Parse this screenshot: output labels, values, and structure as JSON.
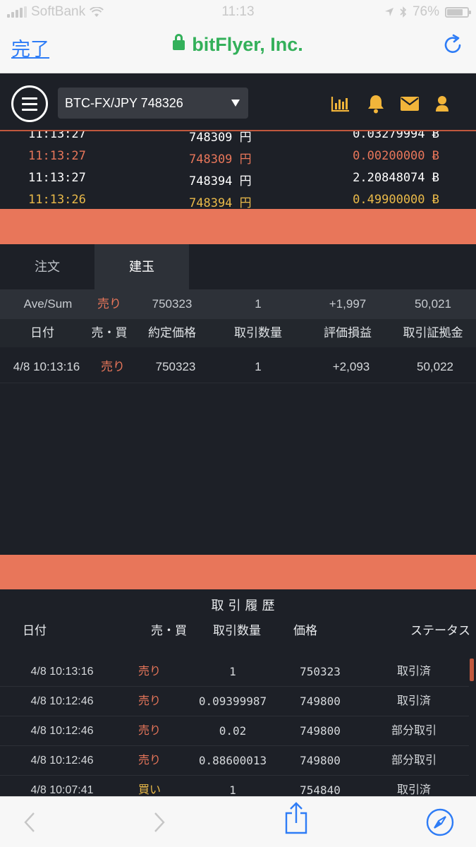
{
  "status_bar": {
    "carrier": "SoftBank",
    "time": "11:13",
    "battery": "76%"
  },
  "browser": {
    "done_label": "完了",
    "site_title": "bitFlyer, Inc."
  },
  "header": {
    "pair": "BTC-FX/JPY 748326"
  },
  "feed": [
    {
      "time": "11:13:27",
      "price": "748309 円",
      "size": "0.03279994 Ƀ",
      "color": "#ffffff"
    },
    {
      "time": "11:13:27",
      "price": "748309 円",
      "size": "0.00200000 Ƀ",
      "color": "#e8765a"
    },
    {
      "time": "11:13:27",
      "price": "748394 円",
      "size": "2.20848074 Ƀ",
      "color": "#ffffff"
    },
    {
      "time": "11:13:26",
      "price": "748394 円",
      "size": "0.49900000 Ƀ",
      "color": "#e9b949"
    }
  ],
  "tabs": {
    "order": "注文",
    "position": "建玉"
  },
  "summary": {
    "label": "Ave/Sum",
    "side": "売り",
    "price": "750323",
    "qty": "1",
    "pnl": "+1,997",
    "margin": "50,021"
  },
  "position_columns": {
    "date": "日付",
    "side": "売・買",
    "price": "約定価格",
    "qty": "取引数量",
    "pnl": "評価損益",
    "margin": "取引証拠金"
  },
  "positions": [
    {
      "date": "4/8 10:13:16",
      "side": "売り",
      "price": "750323",
      "qty": "1",
      "pnl": "+2,093",
      "margin": "50,022"
    }
  ],
  "history": {
    "title": "取引履歴",
    "columns": {
      "date": "日付",
      "side": "売・買",
      "qty": "取引数量",
      "price": "価格",
      "status": "ステータス"
    },
    "rows": [
      {
        "date": "4/8 10:13:16",
        "side": "売り",
        "side_type": "sell",
        "qty": "1",
        "price": "750323",
        "status": "取引済"
      },
      {
        "date": "4/8 10:12:46",
        "side": "売り",
        "side_type": "sell",
        "qty": "0.09399987",
        "price": "749800",
        "status": "取引済"
      },
      {
        "date": "4/8 10:12:46",
        "side": "売り",
        "side_type": "sell",
        "qty": "0.02",
        "price": "749800",
        "status": "部分取引"
      },
      {
        "date": "4/8 10:12:46",
        "side": "売り",
        "side_type": "sell",
        "qty": "0.88600013",
        "price": "749800",
        "status": "部分取引"
      },
      {
        "date": "4/8 10:07:41",
        "side": "買い",
        "side_type": "buy",
        "qty": "1",
        "price": "754840",
        "status": "取引済"
      }
    ]
  },
  "colors": {
    "accent": "#e8765a",
    "buy": "#e9b949",
    "icon_yellow": "#f2b53a",
    "secure_green": "#33b05a",
    "link_blue": "#2e7cf6"
  }
}
